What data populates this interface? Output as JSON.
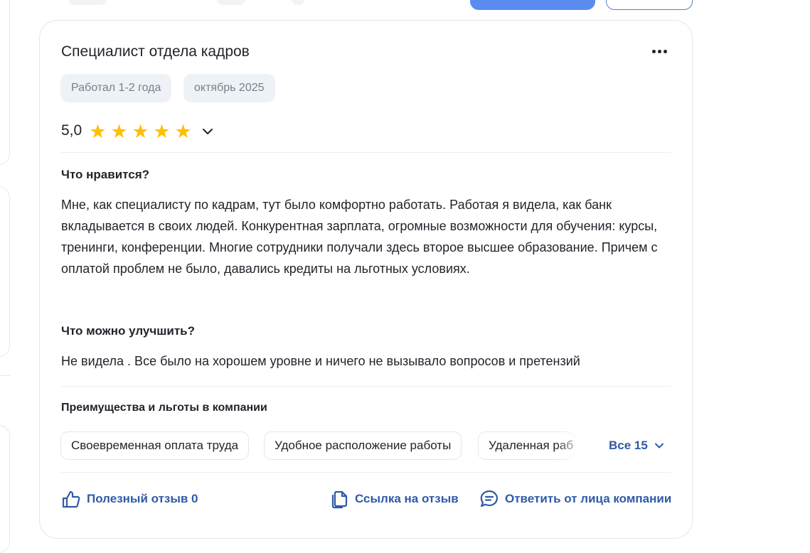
{
  "review": {
    "position_title": "Специалист отдела кадров",
    "tags": [
      "Работал 1-2 года",
      "октябрь 2025"
    ],
    "rating": "5,0",
    "rating_value": 5,
    "rating_max": 5,
    "pros_title": "Что нравится?",
    "pros_text": "Мне, как специалисту по кадрам, тут было комфортно работать. Работая я видела, как банк вкладывается в своих людей. Конкурентная зарплата, огромные возможности для обучения: курсы, тренинги, конференции. Многие сотрудники получали здесь второе высшее образование. Причем с оплатой проблем не было, давались кредиты на льготных условиях.",
    "cons_title": "Что можно улучшить?",
    "cons_text": "Не видела . Все было на хорошем уровне и ничего не вызывало вопросов и претензий",
    "benefits_title": "Преимущества и льготы в компании",
    "benefits": [
      "Своевременная оплата труда",
      "Удобное расположение работы",
      "Удаленная работа"
    ],
    "benefits_all_label": "Все 15",
    "actions": {
      "helpful": "Полезный отзыв 0",
      "link": "Ссылка на отзыв",
      "reply": "Ответить от лица компании"
    }
  },
  "colors": {
    "star": "#ffbf00",
    "link": "#2f5aa8",
    "primary_button": "#5a8cf0",
    "chip_bg": "#eef1f5"
  },
  "icons": [
    "more-icon",
    "star-icon",
    "chevron-down-icon",
    "thumbs-up-icon",
    "copy-link-icon",
    "chat-icon"
  ]
}
